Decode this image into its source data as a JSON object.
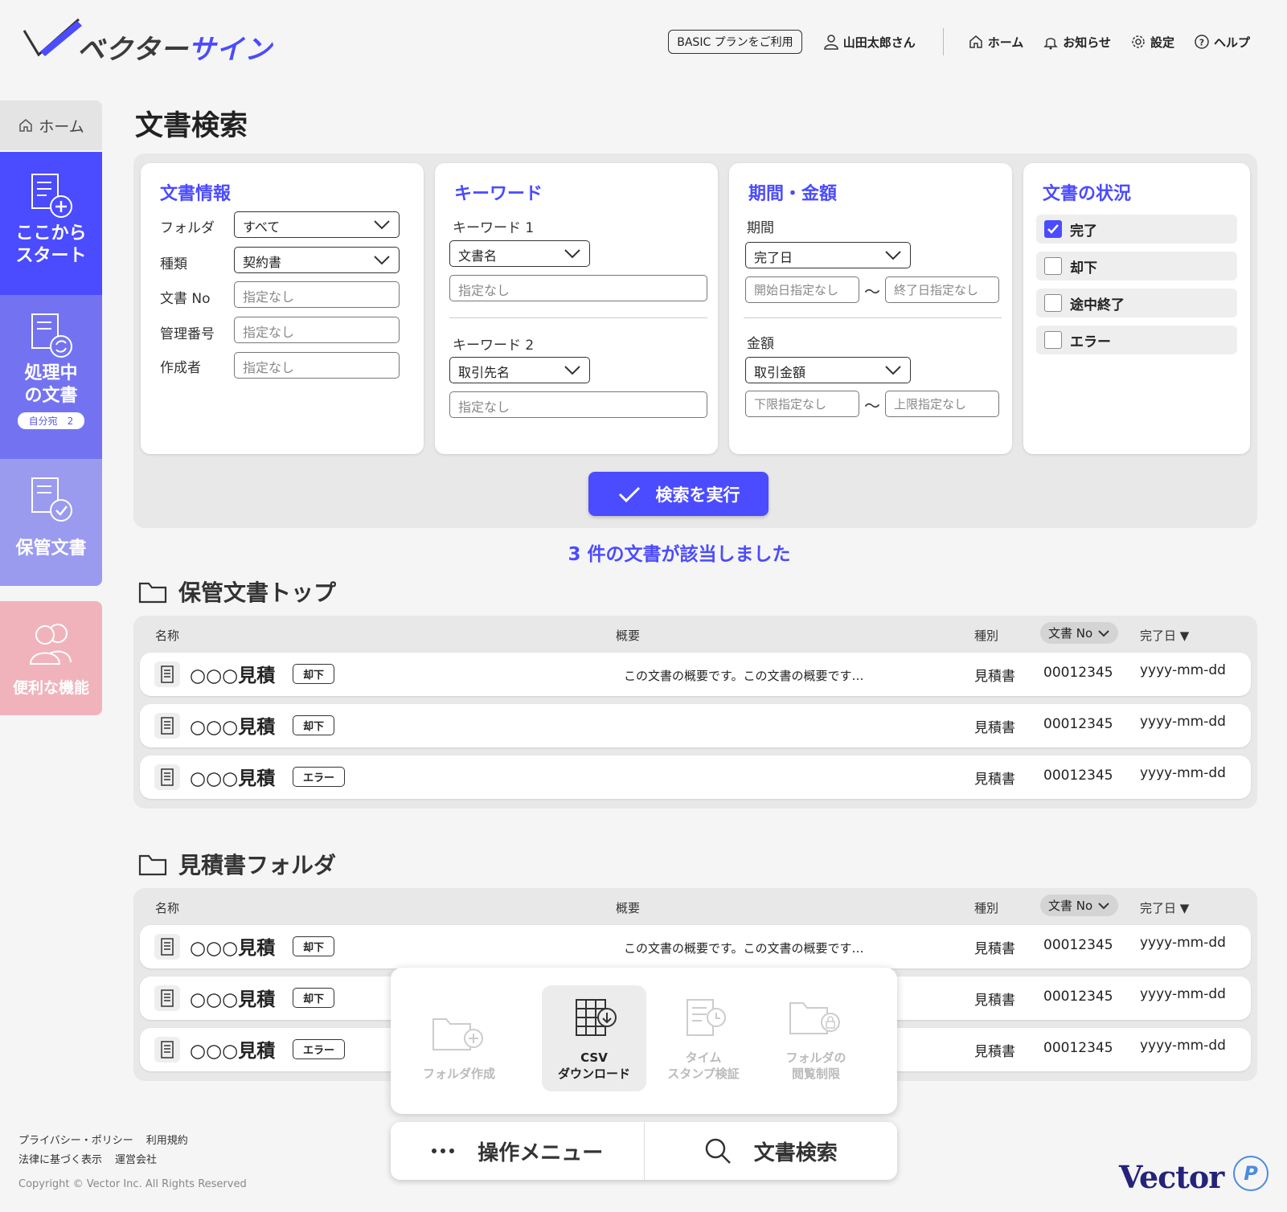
{
  "brand": {
    "name_dark": "ベクター",
    "name_accent": "サイン"
  },
  "header": {
    "plan": "BASIC プランをご利用",
    "user": "山田太郎さん",
    "nav": [
      {
        "label": "ホーム",
        "icon": "home-icon"
      },
      {
        "label": "お知らせ",
        "icon": "bell-icon"
      },
      {
        "label": "設定",
        "icon": "gear-icon"
      },
      {
        "label": "ヘルプ",
        "icon": "help-icon"
      }
    ]
  },
  "sidebar": {
    "home": "ホーム",
    "start": {
      "line1": "ここから",
      "line2": "スタート"
    },
    "processing": {
      "line1": "処理中",
      "line2": "の文書",
      "badge": "自分宛　2"
    },
    "stored": "保管文書",
    "tools": "便利な機能"
  },
  "page_title": "文書検索",
  "search": {
    "doc_info": {
      "title": "文書情報",
      "folder_label": "フォルダ",
      "folder_value": "すべて",
      "type_label": "種類",
      "type_value": "契約書",
      "docno_label": "文書 No",
      "docno_placeholder": "指定なし",
      "mgmt_label": "管理番号",
      "mgmt_placeholder": "指定なし",
      "author_label": "作成者",
      "author_placeholder": "指定なし"
    },
    "keywords": {
      "title": "キーワード",
      "k1_label": "キーワード 1",
      "k1_field": "文書名",
      "k1_placeholder": "指定なし",
      "k2_label": "キーワード 2",
      "k2_field": "取引先名",
      "k2_placeholder": "指定なし"
    },
    "period": {
      "title": "期間・金額",
      "period_label": "期間",
      "period_field": "完了日",
      "start_placeholder": "開始日指定なし",
      "end_placeholder": "終了日指定なし",
      "amount_label": "金額",
      "amount_field": "取引金額",
      "min_placeholder": "下限指定なし",
      "max_placeholder": "上限指定なし",
      "tilde": "〜"
    },
    "status": {
      "title": "文書の状況",
      "items": [
        {
          "label": "完了",
          "checked": true
        },
        {
          "label": "却下",
          "checked": false
        },
        {
          "label": "途中終了",
          "checked": false
        },
        {
          "label": "エラー",
          "checked": false
        }
      ]
    },
    "submit": "検索を実行"
  },
  "result_count": "3 件の文書が該当しました",
  "columns": {
    "name": "名称",
    "summary": "概要",
    "kind": "種別",
    "docno": "文書 No",
    "date": "完了日 ▼"
  },
  "folders": [
    {
      "title": "保管文書トップ",
      "rows": [
        {
          "name": "○○○見積",
          "tag": "却下",
          "summary": "この文書の概要です。この文書の概要です…",
          "kind": "見積書",
          "docno": "00012345",
          "date": "yyyy-mm-dd"
        },
        {
          "name": "○○○見積",
          "tag": "却下",
          "summary": "",
          "kind": "見積書",
          "docno": "00012345",
          "date": "yyyy-mm-dd"
        },
        {
          "name": "○○○見積",
          "tag": "エラー",
          "summary": "",
          "kind": "見積書",
          "docno": "00012345",
          "date": "yyyy-mm-dd"
        }
      ]
    },
    {
      "title": "見積書フォルダ",
      "rows": [
        {
          "name": "○○○見積",
          "tag": "却下",
          "summary": "この文書の概要です。この文書の概要です…",
          "kind": "見積書",
          "docno": "00012345",
          "date": "yyyy-mm-dd"
        },
        {
          "name": "○○○見積",
          "tag": "却下",
          "summary": "",
          "kind": "見積書",
          "docno": "00012345",
          "date": "yyyy-mm-dd"
        },
        {
          "name": "○○○見積",
          "tag": "エラー",
          "summary": "",
          "kind": "見積書",
          "docno": "00012345",
          "date": "yyyy-mm-dd"
        }
      ]
    }
  ],
  "popup": {
    "items": [
      {
        "l1": "フォルダ作成",
        "l2": "",
        "active": false
      },
      {
        "l1": "CSV",
        "l2": "ダウンロード",
        "active": true
      },
      {
        "l1": "タイム",
        "l2": "スタンプ検証",
        "active": false
      },
      {
        "l1": "フォルダの",
        "l2": "閲覧制限",
        "active": false
      }
    ]
  },
  "bottom_bar": {
    "menu": "操作メニュー",
    "search": "文書検索"
  },
  "footer": {
    "privacy": "プライバシー・ポリシー",
    "terms": "利用規約",
    "legal": "法律に基づく表示",
    "company": "運営会社",
    "copyright": "Copyright © Vector Inc. All Rights Reserved",
    "vector_logo": "Vector"
  },
  "colors": {
    "accent": "#4b4bff",
    "panel": "#e8e8e8",
    "tools": "#f0b3bc"
  }
}
